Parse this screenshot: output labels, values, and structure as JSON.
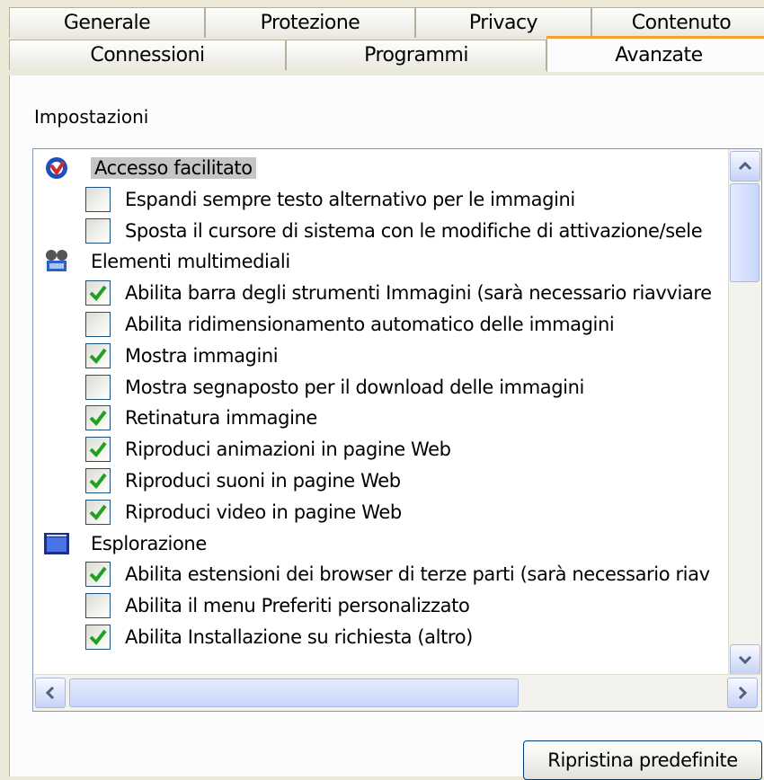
{
  "tabs_row1": [
    "Generale",
    "Protezione",
    "Privacy",
    "Contenuto"
  ],
  "tabs_row2": [
    "Connessioni",
    "Programmi",
    "Avanzate"
  ],
  "active_tab": "Avanzate",
  "settings_label": "Impostazioni",
  "list": [
    {
      "type": "category",
      "icon": "accessibility-icon",
      "label": "Accesso facilitato",
      "selected": true
    },
    {
      "type": "item",
      "checked": false,
      "label": "Espandi sempre testo alternativo per le immagini"
    },
    {
      "type": "item",
      "checked": false,
      "label": "Sposta il cursore di sistema con le modifiche di attivazione/sele"
    },
    {
      "type": "category",
      "icon": "multimedia-icon",
      "label": "Elementi multimediali"
    },
    {
      "type": "item",
      "checked": true,
      "label": "Abilita barra degli strumenti Immagini (sarà necessario riavviare"
    },
    {
      "type": "item",
      "checked": false,
      "label": "Abilita ridimensionamento automatico delle immagini"
    },
    {
      "type": "item",
      "checked": true,
      "label": "Mostra immagini"
    },
    {
      "type": "item",
      "checked": false,
      "label": "Mostra segnaposto per il download delle immagini"
    },
    {
      "type": "item",
      "checked": true,
      "label": "Retinatura immagine"
    },
    {
      "type": "item",
      "checked": true,
      "label": "Riproduci animazioni in pagine Web"
    },
    {
      "type": "item",
      "checked": true,
      "label": "Riproduci suoni in pagine Web"
    },
    {
      "type": "item",
      "checked": true,
      "label": "Riproduci video in pagine Web"
    },
    {
      "type": "category",
      "icon": "browsing-icon",
      "label": "Esplorazione"
    },
    {
      "type": "item",
      "checked": true,
      "label": "Abilita estensioni dei browser di terze parti (sarà necessario riav"
    },
    {
      "type": "item",
      "checked": false,
      "label": "Abilita il menu Preferiti personalizzato"
    },
    {
      "type": "item",
      "checked": true,
      "label": "Abilita Installazione su richiesta (altro)"
    }
  ],
  "restore_button": "Ripristina predefinite",
  "colors": {
    "active_tab_accent": "#f3a12f",
    "check": "#21a121",
    "selection": "#c5c5c5"
  }
}
